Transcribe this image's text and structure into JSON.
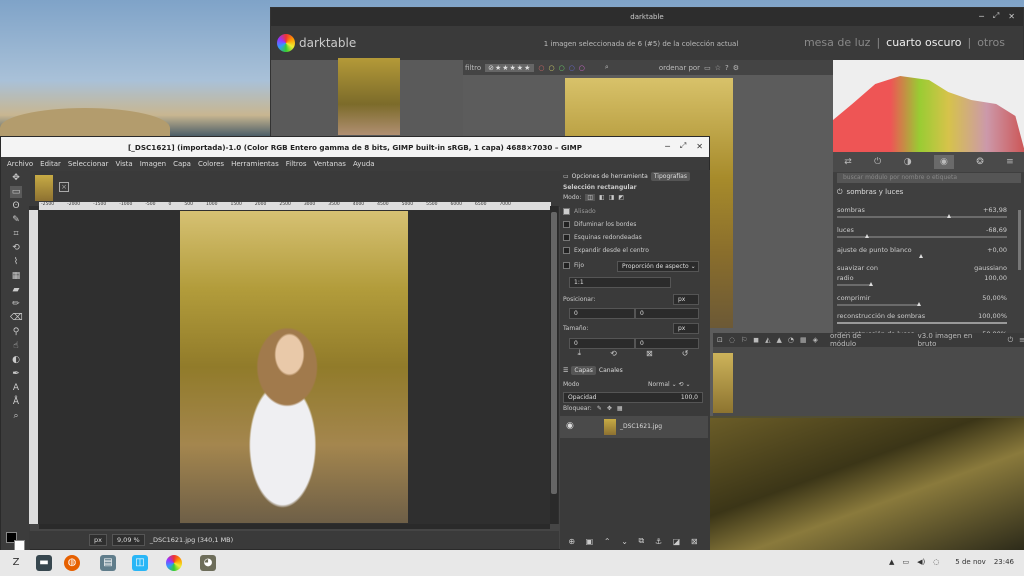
{
  "darktable": {
    "title": "darktable",
    "logo": "darktable",
    "collection_info": "1 imagen seleccionada de 6 (#5) de la colección actual",
    "views": {
      "lighttable": "mesa de luz",
      "sep": "|",
      "darkroom": "cuarto oscuro",
      "others": "otros"
    },
    "filter_label": "filtro",
    "stars": "⊘★★★★★",
    "sort_label": "ordenar por",
    "search_placeholder": "buscar módulo por nombre o etiqueta",
    "module": {
      "title": "sombras y luces",
      "rows": [
        {
          "label": "sombras",
          "value": "+63,98"
        },
        {
          "label": "luces",
          "value": "-68,69"
        },
        {
          "label": "ajuste de punto blanco",
          "value": "+0,00"
        },
        {
          "label": "suavizar con",
          "value": "gaussiano"
        },
        {
          "label": "radio",
          "value": "100,00"
        },
        {
          "label": "comprimir",
          "value": "50,00%"
        },
        {
          "label": "reconstrucción de sombras",
          "value": "100,00%"
        },
        {
          "label": "reconstrucción de luces",
          "value": "50,00%"
        }
      ]
    },
    "bottom": {
      "module_order": "orden de módulo",
      "version": "v3.0 imagen en bruto"
    }
  },
  "gimp": {
    "title": "[_DSC1621] (importada)-1.0 (Color RGB Entero gamma de 8 bits, GIMP built-in sRGB, 1 capa) 4688×7030 – GIMP",
    "menu": [
      "Archivo",
      "Editar",
      "Seleccionar",
      "Vista",
      "Imagen",
      "Capa",
      "Colores",
      "Herramientas",
      "Filtros",
      "Ventanas",
      "Ayuda"
    ],
    "ruler": [
      "-2500",
      "-2000",
      "-1500",
      "-1000",
      "-500",
      "0",
      "500",
      "1000",
      "1500",
      "2000",
      "2500",
      "3000",
      "3500",
      "4000",
      "4500",
      "5000",
      "5500",
      "6000",
      "6500",
      "7000"
    ],
    "status": {
      "unit": "px",
      "zoom": "9,09 %",
      "file": "_DSC1621.jpg (340,1 MB)"
    },
    "dock": {
      "tab_tool_options": "Opciones de herramienta",
      "tab_fonts": "Tipografías",
      "tool_name": "Selección rectangular",
      "mode_label": "Modo:",
      "antialias": "Alisado",
      "feather": "Difuminar los bordes",
      "rounded": "Esquinas redondeadas",
      "expand_center": "Expandir desde el centro",
      "fixed": "Fijo",
      "aspect": "Proporción de aspecto",
      "ratio_value": "1:1",
      "position_label": "Posicionar:",
      "size_label": "Tamaño:",
      "unit": "px",
      "zero": "0",
      "tab_layers": "Capas",
      "tab_channels": "Canales",
      "layer_mode_label": "Modo",
      "layer_mode_value": "Normal",
      "opacity_label": "Opacidad",
      "opacity_value": "100,0",
      "lock_label": "Bloquear:",
      "layer_name": "_DSC1621.jpg"
    }
  },
  "taskbar": {
    "date": "5 de nov",
    "time": "23:46"
  }
}
